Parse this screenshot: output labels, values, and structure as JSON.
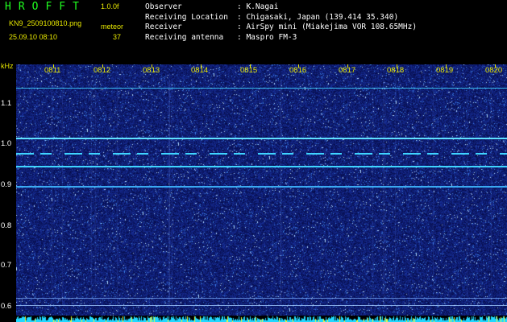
{
  "header": {
    "app_title": "HROFFT",
    "version": "1.0.0f",
    "filename": "KN9_2509100810.png",
    "datetime": "25.09.10 08:10",
    "meteor_label": "meteor",
    "meteor_count": "37"
  },
  "info": [
    {
      "key": "Observer",
      "value": ": K.Nagai"
    },
    {
      "key": "Receiving Location",
      "value": ": Chigasaki, Japan (139.414 35.340)"
    },
    {
      "key": "Receiver",
      "value": ": AirSpy mini (Miakejima VOR 108.65MHz)"
    },
    {
      "key": "Receiving antenna",
      "value": ": Maspro FM-3"
    }
  ],
  "axis": {
    "y_unit": "kHz",
    "y_ticks": [
      "1.1",
      "1.0",
      "0.9",
      "0.8",
      "0.7",
      "0.6"
    ],
    "x_ticks": [
      "0811",
      "0812",
      "0813",
      "0814",
      "0815",
      "0816",
      "0817",
      "0818",
      "0819",
      "0820"
    ]
  },
  "colors": {
    "background": "#0c1470",
    "accent": "#e8e800",
    "title": "#20ff20",
    "signal": "#3fd4ff"
  }
}
